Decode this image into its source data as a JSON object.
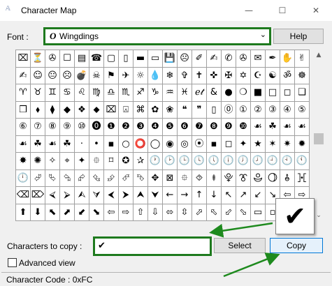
{
  "window": {
    "title": "Character Map",
    "app_icon": "charmap-icon",
    "buttons": [
      "minimize",
      "maximize",
      "close"
    ]
  },
  "font": {
    "label": "Font :",
    "glyph": "O",
    "value": "Wingdings",
    "help_label": "Help"
  },
  "grid": {
    "rows": [
      [
        "⌧",
        "⏳",
        "✇",
        "☐",
        "▤",
        "☎",
        "▢",
        "▯",
        "▬",
        "▭",
        "💾",
        "☹",
        "✐",
        "✍",
        "✆",
        "✇",
        "✉",
        "✒",
        "✋",
        "✌"
      ],
      [
        "✍",
        "☺",
        "😐",
        "☹",
        "💣",
        "☠",
        "⚑",
        "✈",
        "☼",
        "💧",
        "❄",
        "✞",
        "✝",
        "✜",
        "✠",
        "✡",
        "☪",
        "☯",
        "ॐ",
        "☸"
      ],
      [
        "♈",
        "♉",
        "♊",
        "♋",
        "♌",
        "♍",
        "♎",
        "♏",
        "♐",
        "♑",
        "♒",
        "♓",
        "ℯ𝓉",
        "&",
        "●",
        "❍",
        "■",
        "□",
        "◻",
        "❑"
      ],
      [
        "❒",
        "⬧",
        "⧫",
        "◆",
        "❖",
        "⬥",
        "⌧",
        "⍓",
        "⌘",
        "✿",
        "❀",
        "❝",
        "❞",
        "▯",
        "⓪",
        "①",
        "②",
        "③",
        "④",
        "⑤"
      ],
      [
        "⑥",
        "⑦",
        "⑧",
        "⑨",
        "⑩",
        "⓿",
        "❶",
        "❷",
        "❸",
        "❹",
        "❺",
        "❻",
        "❼",
        "❽",
        "❾",
        "❿",
        "☙",
        "☘",
        "☙",
        "☙"
      ],
      [
        "☙",
        "☘",
        "☙",
        "☘",
        "·",
        "•",
        "▪",
        "○",
        "⭕",
        "◯",
        "◉",
        "◎",
        "⦿",
        "▪",
        "◻",
        "✦",
        "★",
        "✶",
        "✷",
        "✹"
      ],
      [
        "✸",
        "✺",
        "✧",
        "⌖",
        "✦",
        "⯐",
        "⌑",
        "✪",
        "✰",
        "🕐",
        "🕑",
        "🕒",
        "🕓",
        "🕔",
        "🕕",
        "🕖",
        "🕗",
        "🕘",
        "🕙",
        "🕚"
      ],
      [
        "🕛",
        "⮰",
        "⮱",
        "⮲",
        "⮳",
        "⮴",
        "⮵",
        "⮶",
        "⮷",
        "✥",
        "⊠",
        "⯐",
        "⯑",
        "⯒",
        "⯓",
        "⯔",
        "⯕",
        "⯖",
        "⯗",
        "⯘"
      ],
      [
        "⌫",
        "⌦",
        "⮘",
        "⮚",
        "⮙",
        "⮛",
        "⮜",
        "⮞",
        "⮝",
        "⮟",
        "←",
        "→",
        "↑",
        "↓",
        "↖",
        "↗",
        "↙",
        "↘",
        "⇦",
        "⇨"
      ],
      [
        "⬆",
        "⬇",
        "⬉",
        "⬈",
        "⬋",
        "⬊",
        "⇦",
        "⇨",
        "⇧",
        "⇩",
        "⬄",
        "⇳",
        "⬀",
        "⬁",
        "⬃",
        "⬂",
        "▭",
        "▫",
        "✗",
        "✔"
      ]
    ]
  },
  "preview": {
    "char": "✔"
  },
  "copy": {
    "label": "Characters to copy :",
    "value": "✔",
    "select_label": "Select",
    "copy_label": "Copy"
  },
  "advanced": {
    "label": "Advanced view",
    "checked": false
  },
  "status": {
    "text": "Character Code : 0xFC"
  },
  "colors": {
    "highlight_border": "#1e7a1e",
    "arrow": "#1e8a1e",
    "window_bg": "#f0f0f0"
  }
}
